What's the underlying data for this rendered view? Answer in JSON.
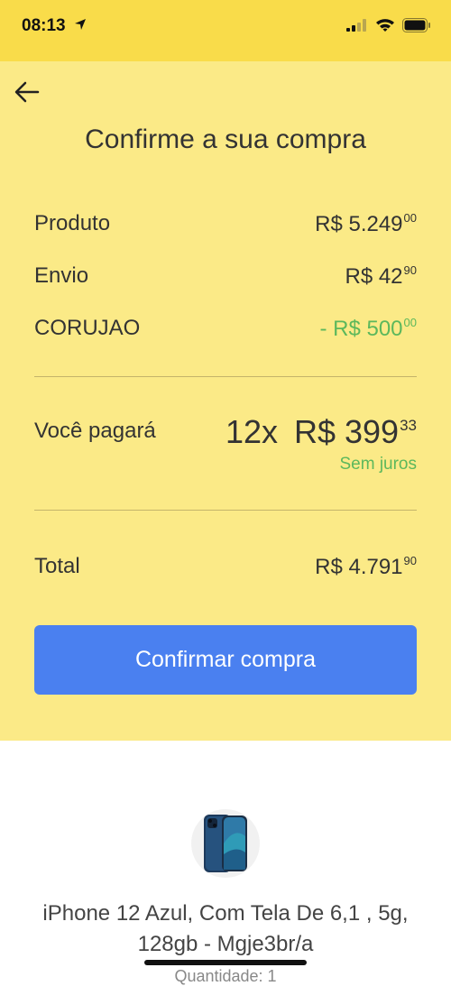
{
  "status_bar": {
    "time": "08:13"
  },
  "header": {
    "title": "Confirme a sua compra"
  },
  "summary": {
    "product": {
      "label": "Produto",
      "value": "R$ 5.249",
      "cents": "00"
    },
    "shipping": {
      "label": "Envio",
      "value": "R$ 42",
      "cents": "90"
    },
    "coupon": {
      "label": "CORUJAO",
      "value": "- R$ 500",
      "cents": "00"
    }
  },
  "payment": {
    "label": "Você pagará",
    "installments": "12x",
    "installment_value": "R$ 399",
    "installment_cents": "33",
    "interest_note": "Sem juros"
  },
  "total": {
    "label": "Total",
    "value": "R$ 4.791",
    "cents": "90"
  },
  "confirm_button": {
    "label": "Confirmar compra"
  },
  "product": {
    "name": "iPhone 12 Azul, Com Tela De 6,1 , 5g, 128gb - Mgje3br/a",
    "quantity": "Quantidade: 1"
  },
  "colors": {
    "header_yellow": "#f9dc4a",
    "panel_yellow": "#fbea87",
    "button_blue": "#4a80f0",
    "discount_green": "#5cb85c"
  }
}
